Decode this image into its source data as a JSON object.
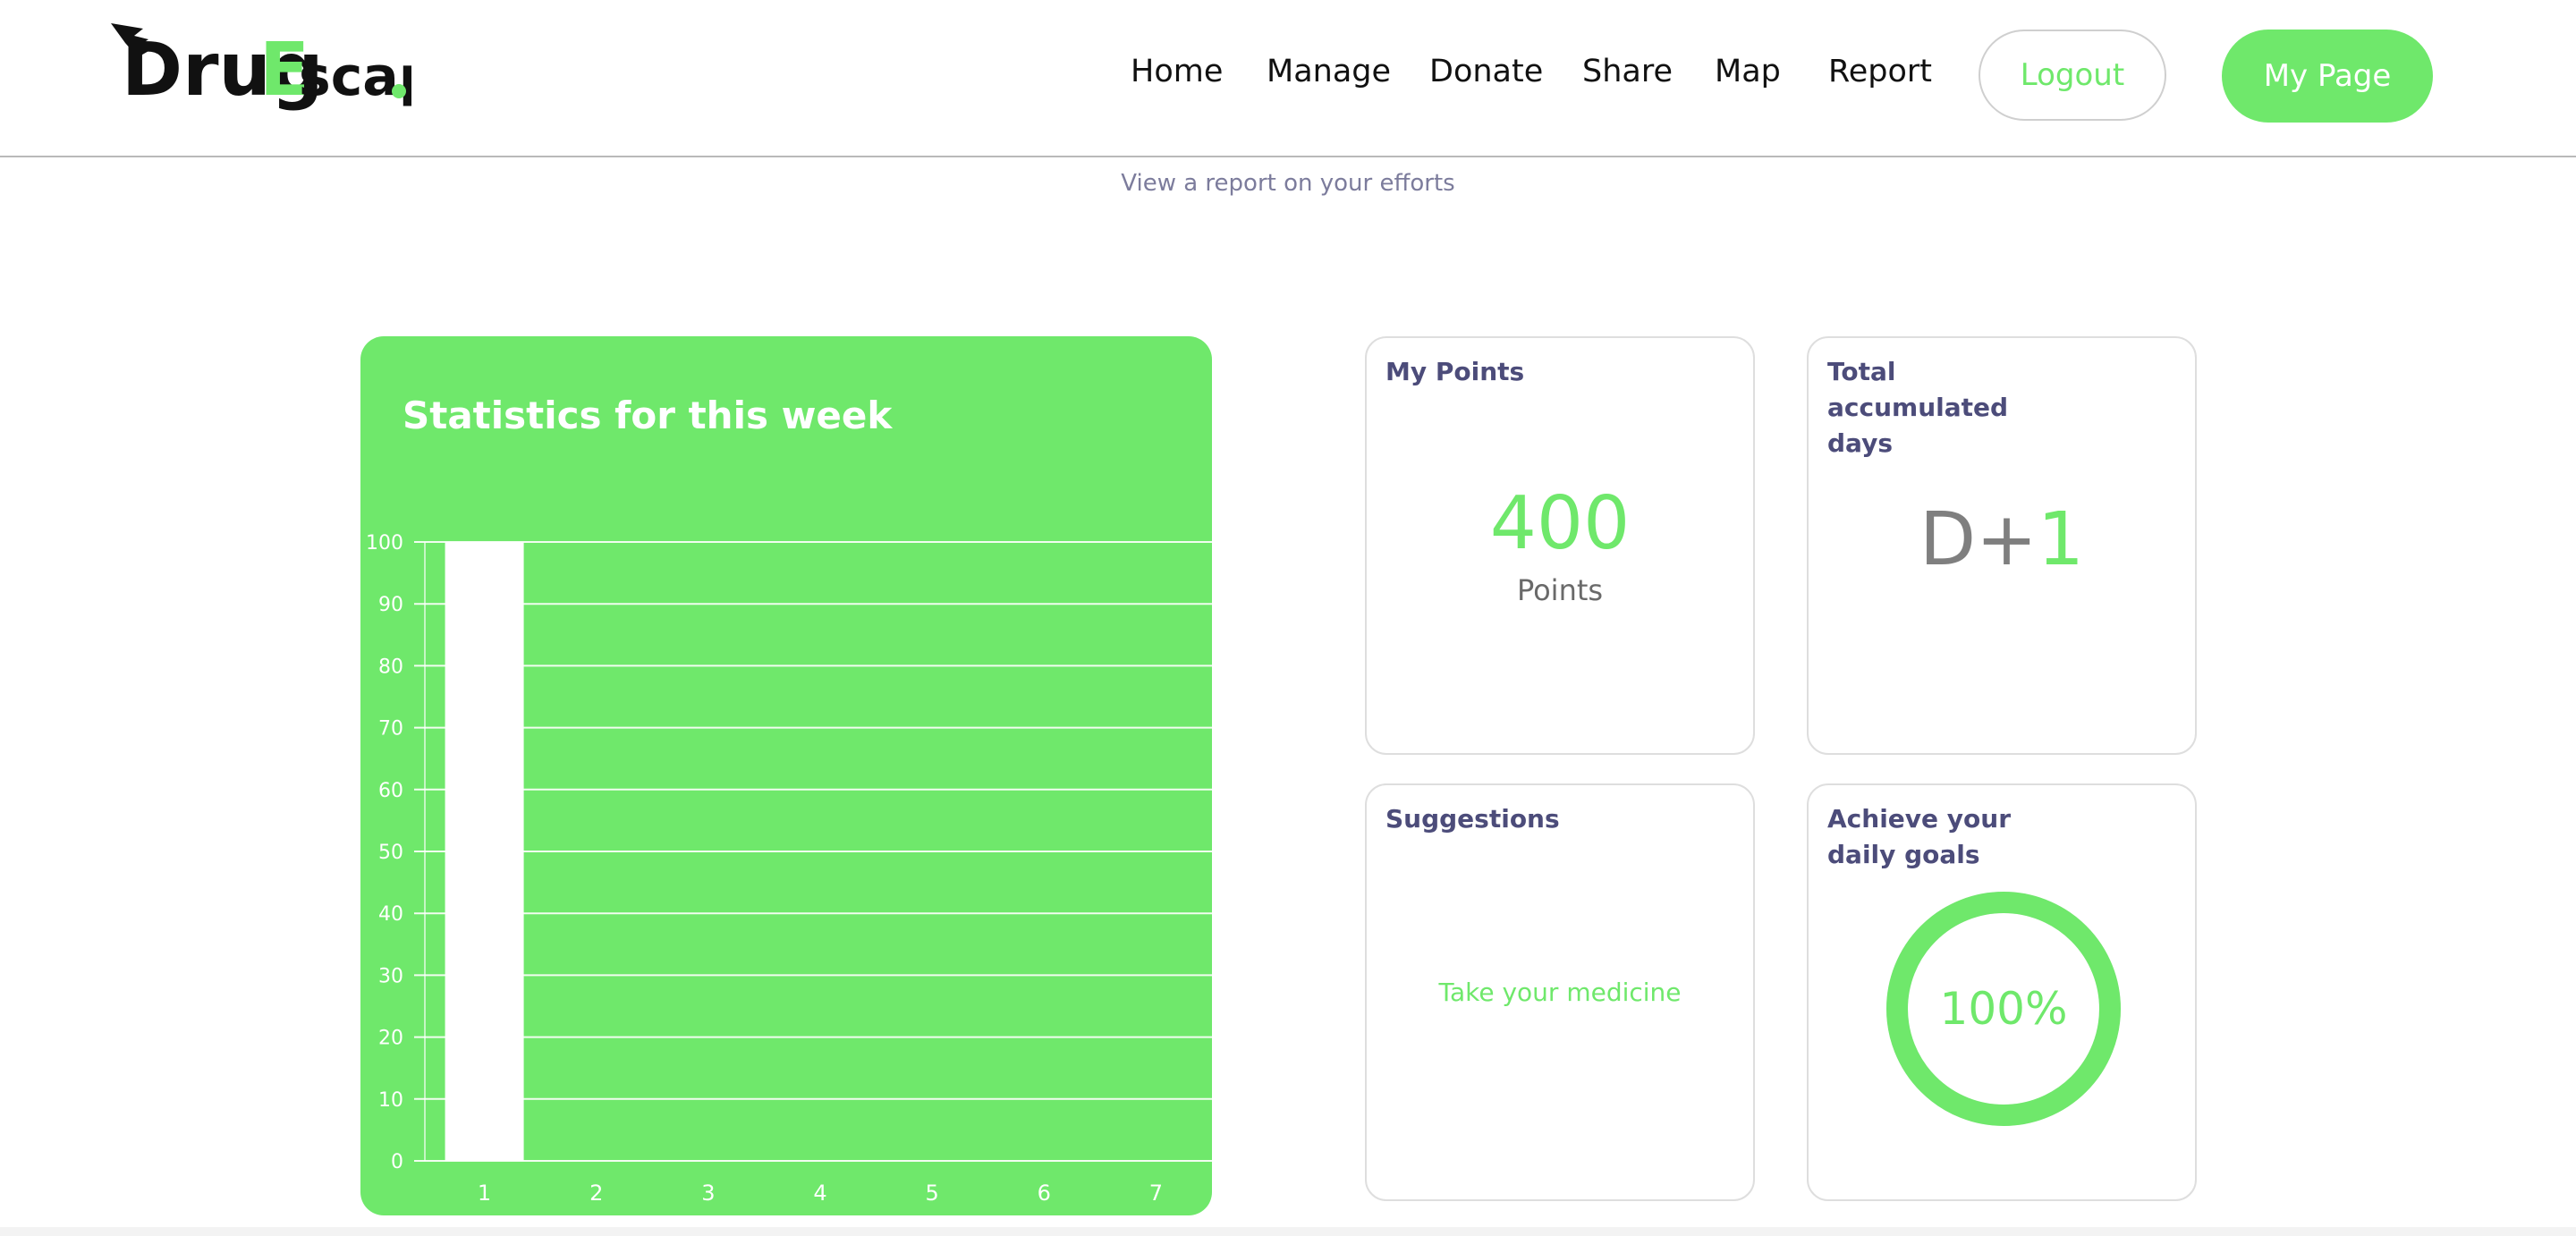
{
  "brand": {
    "logo_text_1": "Drug",
    "logo_text_2": "Escape",
    "accent": "#6fe86b"
  },
  "nav": {
    "home": "Home",
    "manage": "Manage",
    "donate": "Donate",
    "share": "Share",
    "map": "Map",
    "report": "Report",
    "logout": "Logout",
    "mypage": "My Page"
  },
  "page": {
    "subtitle": "View a report on your efforts"
  },
  "chart_data": {
    "type": "bar",
    "title": "Statistics for this week",
    "categories": [
      "1",
      "2",
      "3",
      "4",
      "5",
      "6",
      "7"
    ],
    "values": [
      100,
      0,
      0,
      0,
      0,
      0,
      0
    ],
    "ylim": [
      0,
      100
    ],
    "yticks": [
      0,
      10,
      20,
      30,
      40,
      50,
      60,
      70,
      80,
      90,
      100
    ],
    "grid": true,
    "xlabel": "",
    "ylabel": "",
    "bar_color": "#ffffff",
    "background": "#6fe86b"
  },
  "cards": {
    "points": {
      "title": "My Points",
      "value": "400",
      "unit": "Points"
    },
    "days": {
      "title": "Total accumulated days",
      "prefix": "D+",
      "value": "1"
    },
    "suggestions": {
      "title": "Suggestions",
      "text": "Take your medicine"
    },
    "goals": {
      "title": "Achieve your daily goals",
      "value": "100%",
      "progress": 1.0
    }
  }
}
